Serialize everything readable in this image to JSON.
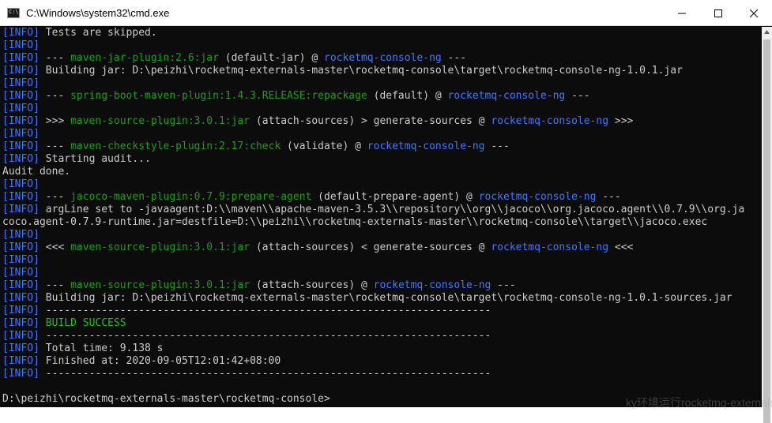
{
  "window": {
    "title": "C:\\Windows\\system32\\cmd.exe",
    "icon_label": "C:\\"
  },
  "console": {
    "lines": [
      {
        "parts": [
          {
            "t": "[",
            "c": "info"
          },
          {
            "t": "INFO",
            "c": "info"
          },
          {
            "t": "]",
            "c": "info"
          },
          {
            "t": " Tests are skipped.",
            "c": ""
          }
        ]
      },
      {
        "parts": [
          {
            "t": "[INFO]",
            "c": "info"
          }
        ]
      },
      {
        "parts": [
          {
            "t": "[INFO]",
            "c": "info"
          },
          {
            "t": " --- ",
            "c": ""
          },
          {
            "t": "maven-jar-plugin:2.6:jar",
            "c": "plugin"
          },
          {
            "t": " (default-jar) @ ",
            "c": ""
          },
          {
            "t": "rocketmq-console-ng",
            "c": "project"
          },
          {
            "t": " ---",
            "c": ""
          }
        ]
      },
      {
        "parts": [
          {
            "t": "[INFO]",
            "c": "info"
          },
          {
            "t": " Building jar: D:\\peizhi\\rocketmq-externals-master\\rocketmq-console\\target\\rocketmq-console-ng-1.0.1.jar",
            "c": ""
          }
        ]
      },
      {
        "parts": [
          {
            "t": "[INFO]",
            "c": "info"
          }
        ]
      },
      {
        "parts": [
          {
            "t": "[INFO]",
            "c": "info"
          },
          {
            "t": " --- ",
            "c": ""
          },
          {
            "t": "spring-boot-maven-plugin:1.4.3.RELEASE:repackage",
            "c": "plugin"
          },
          {
            "t": " (default) @ ",
            "c": ""
          },
          {
            "t": "rocketmq-console-ng",
            "c": "project"
          },
          {
            "t": " ---",
            "c": ""
          }
        ]
      },
      {
        "parts": [
          {
            "t": "[INFO]",
            "c": "info"
          }
        ]
      },
      {
        "parts": [
          {
            "t": "[INFO]",
            "c": "info"
          },
          {
            "t": " >>> ",
            "c": ""
          },
          {
            "t": "maven-source-plugin:3.0.1:jar",
            "c": "plugin"
          },
          {
            "t": " (attach-sources) > generate-sources @ ",
            "c": ""
          },
          {
            "t": "rocketmq-console-ng",
            "c": "project"
          },
          {
            "t": " >>>",
            "c": ""
          }
        ]
      },
      {
        "parts": [
          {
            "t": "[INFO]",
            "c": "info"
          }
        ]
      },
      {
        "parts": [
          {
            "t": "[INFO]",
            "c": "info"
          },
          {
            "t": " --- ",
            "c": ""
          },
          {
            "t": "maven-checkstyle-plugin:2.17:check",
            "c": "plugin"
          },
          {
            "t": " (validate) @ ",
            "c": ""
          },
          {
            "t": "rocketmq-console-ng",
            "c": "project"
          },
          {
            "t": " ---",
            "c": ""
          }
        ]
      },
      {
        "parts": [
          {
            "t": "[INFO]",
            "c": "info"
          },
          {
            "t": " Starting audit...",
            "c": ""
          }
        ]
      },
      {
        "parts": [
          {
            "t": "Audit done.",
            "c": ""
          }
        ]
      },
      {
        "parts": [
          {
            "t": "[INFO]",
            "c": "info"
          }
        ]
      },
      {
        "parts": [
          {
            "t": "[INFO]",
            "c": "info"
          },
          {
            "t": " --- ",
            "c": ""
          },
          {
            "t": "jacoco-maven-plugin:0.7.9:prepare-agent",
            "c": "plugin"
          },
          {
            "t": " (default-prepare-agent) @ ",
            "c": ""
          },
          {
            "t": "rocketmq-console-ng",
            "c": "project"
          },
          {
            "t": " ---",
            "c": ""
          }
        ]
      },
      {
        "parts": [
          {
            "t": "[INFO]",
            "c": "info"
          },
          {
            "t": " argLine set to -javaagent:D:\\\\maven\\\\apache-maven-3.5.3\\\\repository\\\\org\\\\jacoco\\\\org.jacoco.agent\\\\0.7.9\\\\org.ja",
            "c": ""
          }
        ]
      },
      {
        "parts": [
          {
            "t": "coco.agent-0.7.9-runtime.jar=destfile=D:\\\\peizhi\\\\rocketmq-externals-master\\\\rocketmq-console\\\\target\\\\jacoco.exec",
            "c": ""
          }
        ]
      },
      {
        "parts": [
          {
            "t": "[INFO]",
            "c": "info"
          }
        ]
      },
      {
        "parts": [
          {
            "t": "[INFO]",
            "c": "info"
          },
          {
            "t": " <<< ",
            "c": ""
          },
          {
            "t": "maven-source-plugin:3.0.1:jar",
            "c": "plugin"
          },
          {
            "t": " (attach-sources) < generate-sources @ ",
            "c": ""
          },
          {
            "t": "rocketmq-console-ng",
            "c": "project"
          },
          {
            "t": " <<<",
            "c": ""
          }
        ]
      },
      {
        "parts": [
          {
            "t": "[INFO]",
            "c": "info"
          }
        ]
      },
      {
        "parts": [
          {
            "t": "[INFO]",
            "c": "info"
          }
        ]
      },
      {
        "parts": [
          {
            "t": "[INFO]",
            "c": "info"
          },
          {
            "t": " --- ",
            "c": ""
          },
          {
            "t": "maven-source-plugin:3.0.1:jar",
            "c": "plugin"
          },
          {
            "t": " (attach-sources) @ ",
            "c": ""
          },
          {
            "t": "rocketmq-console-ng",
            "c": "project"
          },
          {
            "t": " ---",
            "c": ""
          }
        ]
      },
      {
        "parts": [
          {
            "t": "[INFO]",
            "c": "info"
          },
          {
            "t": " Building jar: D:\\peizhi\\rocketmq-externals-master\\rocketmq-console\\target\\rocketmq-console-ng-1.0.1-sources.jar",
            "c": ""
          }
        ]
      },
      {
        "parts": [
          {
            "t": "[INFO]",
            "c": "info"
          },
          {
            "t": " ------------------------------------------------------------------------",
            "c": ""
          }
        ]
      },
      {
        "parts": [
          {
            "t": "[INFO]",
            "c": "info"
          },
          {
            "t": " BUILD SUCCESS",
            "c": "success"
          }
        ]
      },
      {
        "parts": [
          {
            "t": "[INFO]",
            "c": "info"
          },
          {
            "t": " ------------------------------------------------------------------------",
            "c": ""
          }
        ]
      },
      {
        "parts": [
          {
            "t": "[INFO]",
            "c": "info"
          },
          {
            "t": " Total time: 9.138 s",
            "c": ""
          }
        ]
      },
      {
        "parts": [
          {
            "t": "[INFO]",
            "c": "info"
          },
          {
            "t": " Finished at: 2020-09-05T12:01:42+08:00",
            "c": ""
          }
        ]
      },
      {
        "parts": [
          {
            "t": "[INFO]",
            "c": "info"
          },
          {
            "t": " ------------------------------------------------------------------------",
            "c": ""
          }
        ]
      },
      {
        "parts": [
          {
            "t": "",
            "c": ""
          }
        ]
      },
      {
        "parts": [
          {
            "t": "D:\\peizhi\\rocketmq-externals-master\\rocketmq-console>",
            "c": ""
          }
        ]
      }
    ]
  },
  "colors": {
    "console_bg": "#0c0c0c",
    "console_fg": "#cccccc",
    "info": "#3b78ff",
    "plugin": "#13a10e",
    "success": "#16c60c"
  },
  "icons": {
    "minimize": "minimize-icon",
    "maximize": "maximize-icon",
    "close": "close-icon"
  },
  "overlay": {
    "text": "ky环境运行rocketmq-externals"
  }
}
